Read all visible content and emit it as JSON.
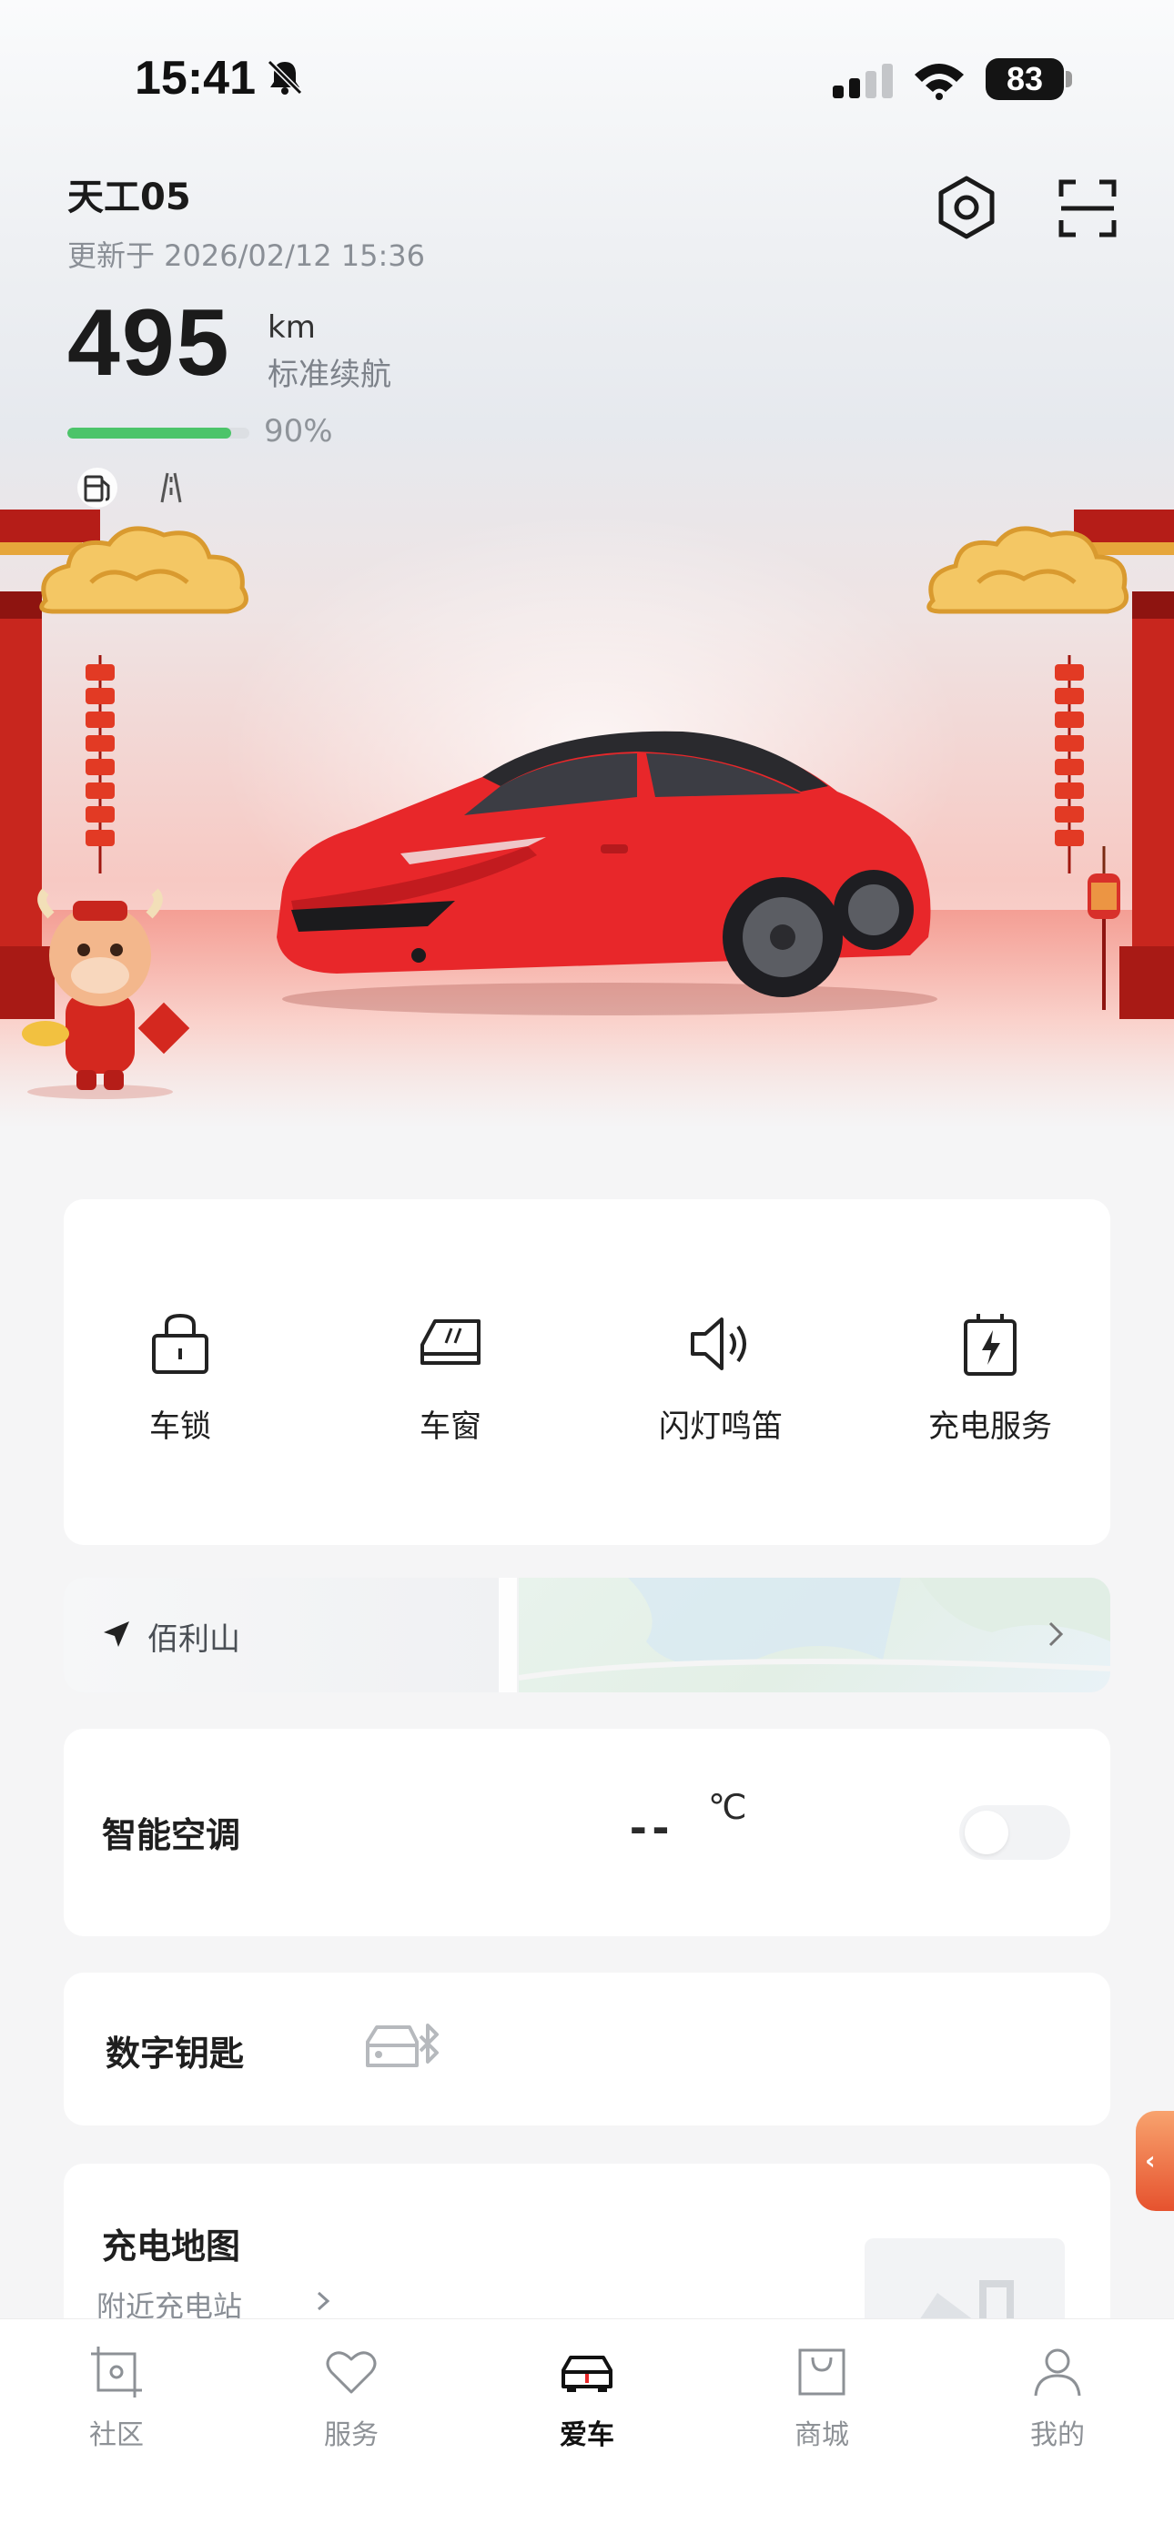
{
  "status_bar": {
    "time": "15:41",
    "battery_level": "83"
  },
  "vehicle": {
    "name": "天工05",
    "update_time": "更新于 2026/02/12 15:36",
    "range_value": "495",
    "range_unit": "km",
    "range_type": "标准续航",
    "battery_percent_text": "90%",
    "battery_fraction": 0.9
  },
  "quick_actions": [
    {
      "label": "车锁",
      "icon": "lock-icon"
    },
    {
      "label": "车窗",
      "icon": "window-icon"
    },
    {
      "label": "闪灯鸣笛",
      "icon": "speaker-icon"
    },
    {
      "label": "充电服务",
      "icon": "charging-icon"
    }
  ],
  "location": {
    "place": "佰利山"
  },
  "climate": {
    "label": "智能空调",
    "temperature": "--",
    "unit": "℃",
    "enabled": false
  },
  "digital_key": {
    "label": "数字钥匙",
    "icon": "car-bluetooth-icon"
  },
  "charging_map": {
    "title": "充电地图",
    "subtitle": "附近充电站"
  },
  "side_tab": {
    "glyph": "‹"
  },
  "tabbar": {
    "items": [
      {
        "label": "社区",
        "icon": "community-icon"
      },
      {
        "label": "服务",
        "icon": "heart-icon"
      },
      {
        "label": "爱车",
        "icon": "car-icon"
      },
      {
        "label": "商城",
        "icon": "bag-icon"
      },
      {
        "label": "我的",
        "icon": "person-icon"
      }
    ],
    "active_index": 2
  },
  "colors": {
    "accent_green": "#4cc46a",
    "car_red": "#e8272a",
    "festive_red": "#c8261e",
    "gold": "#f1b63a"
  }
}
